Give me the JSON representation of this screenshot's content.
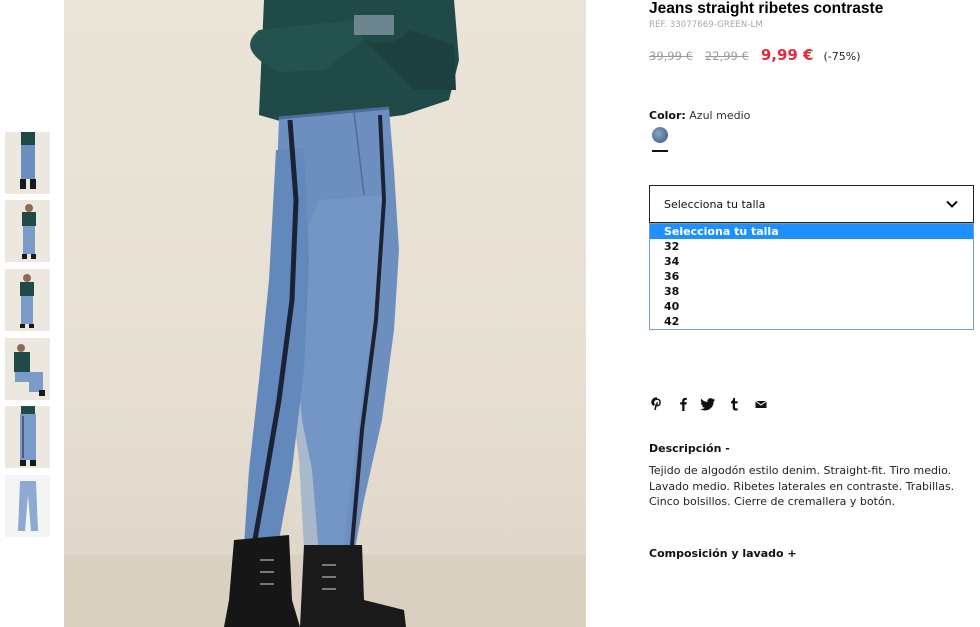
{
  "product": {
    "title": "Jeans straight ribetes contraste",
    "ref": "REF. 33077669-GREEN-LM",
    "old_prices": [
      "39,99 €",
      "22,99 €"
    ],
    "sale_price": "9,99 €",
    "discount": "(-75%)"
  },
  "color": {
    "label": "Color:",
    "value": "Azul medio",
    "swatch_color": "#5a76a0"
  },
  "size_select": {
    "selected": "Selecciona tu talla",
    "options": [
      "Selecciona tu talla",
      "32",
      "34",
      "36",
      "38",
      "40",
      "42"
    ],
    "highlight_color": "#1e90ff"
  },
  "share_icons": [
    "pinterest-icon",
    "facebook-icon",
    "twitter-icon",
    "tumblr-icon",
    "email-icon"
  ],
  "description": {
    "heading": "Descripción -",
    "body": "Tejido de algodón estilo denim. Straight-fit. Tiro medio. Lavado medio. Ribetes laterales en contraste. Trabillas. Cinco bolsillos. Cierre de cremallera y botón."
  },
  "composition": {
    "heading": "Composición y lavado +"
  },
  "gallery": {
    "thumbnail_count": 6
  },
  "colors": {
    "price_red": "#e1293b",
    "sweater_green": "#1f4a47",
    "denim": "#6d8fc0"
  }
}
